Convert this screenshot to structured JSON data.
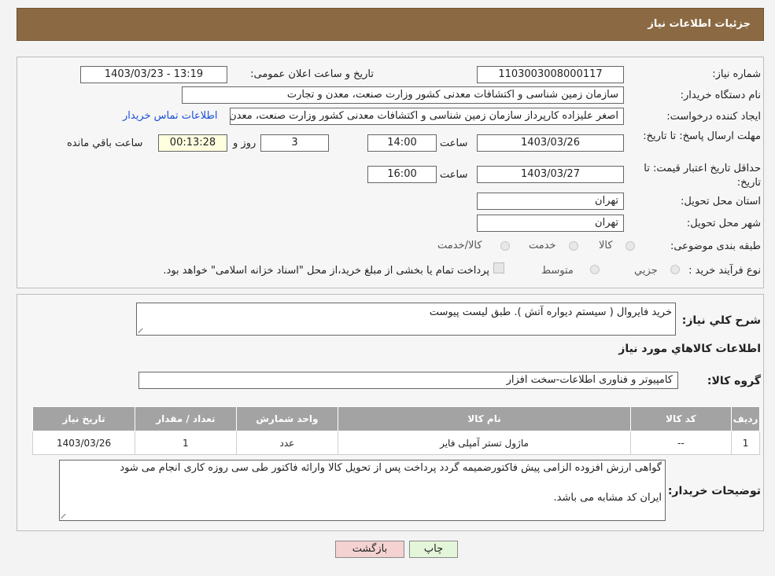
{
  "header": {
    "title": "جزئیات اطلاعات نیاز"
  },
  "labels": {
    "need_number": "شماره نیاز:",
    "announce_datetime": "تاریخ و ساعت اعلان عمومی:",
    "buyer_org": "نام دستگاه خریدار:",
    "requester": "ایجاد کننده درخواست:",
    "contact_link": "اطلاعات تماس خریدار",
    "reply_deadline": "مهلت ارسال پاسخ: تا تاریخ:",
    "time_word": "ساعت",
    "day_and": "روز و",
    "remaining": "ساعت باقي مانده",
    "price_validity": "حداقل تاریخ اعتبار قیمت: تا تاریخ:",
    "province": "استان محل تحویل:",
    "city": "شهر محل تحویل:",
    "category": "طبقه بندی موضوعی:",
    "process_type": "نوع فرآیند خرید :",
    "need_description": "شرح کلي نياز:",
    "goods_info": "اطلاعات کالاهاي مورد نياز",
    "goods_group": "گروه کالا:",
    "buyer_notes": "توضیحات خریدار:"
  },
  "values": {
    "need_number": "1103003008000117",
    "announce_datetime": "1403/03/23 - 13:19",
    "buyer_org": "سازمان زمین شناسی و اکتشافات معدنی کشور وزارت صنعت، معدن و تجارت",
    "requester": "اصغر علیزاده کارپرداز سازمان زمین شناسی و اکتشافات معدنی کشور وزارت صنعت، معدن و تجارت",
    "reply_date": "1403/03/26",
    "reply_time": "14:00",
    "days": "3",
    "remaining_time": "00:13:28",
    "validity_date": "1403/03/27",
    "validity_time": "16:00",
    "province": "تهران",
    "city": "تهران",
    "need_description": "خرید فایروال ( سیستم  دیواره آتش ). طبق لیست پیوست",
    "goods_group": "کامپیوتر و فناوری اطلاعات-سخت افزار",
    "buyer_notes_line1": "گواهی ارزش افزوده الزامی پیش فاکتورضمیمه گردد پرداخت پس از تحویل کالا وارائه فاکتور طی سی روزه کاری انجام می شود",
    "buyer_notes_line2": "ایران کد مشابه می باشد."
  },
  "category_options": [
    "کالا",
    "خدمت",
    "کالا/خدمت"
  ],
  "process_options": [
    "جزيي",
    "متوسط"
  ],
  "process_note": "پرداخت تمام یا بخشی از مبلغ خرید،از محل \"اسناد خزانه اسلامی\" خواهد بود.",
  "table": {
    "headers": [
      "ردیف",
      "کد کالا",
      "نام کالا",
      "واحد شمارش",
      "تعداد / مقدار",
      "تاریخ نیاز"
    ],
    "rows": [
      [
        "1",
        "--",
        "ماژول تستر آمپلی فایر",
        "عدد",
        "1",
        "1403/03/26"
      ]
    ]
  },
  "buttons": {
    "print": "چاپ",
    "back": "بازگشت"
  },
  "colors": {
    "header_bg": "#8b6a43",
    "link": "#1a4fd6",
    "back_btn": "#f5d2d2",
    "print_btn": "#e4f6d9",
    "table_header": "#a3a3a3"
  }
}
